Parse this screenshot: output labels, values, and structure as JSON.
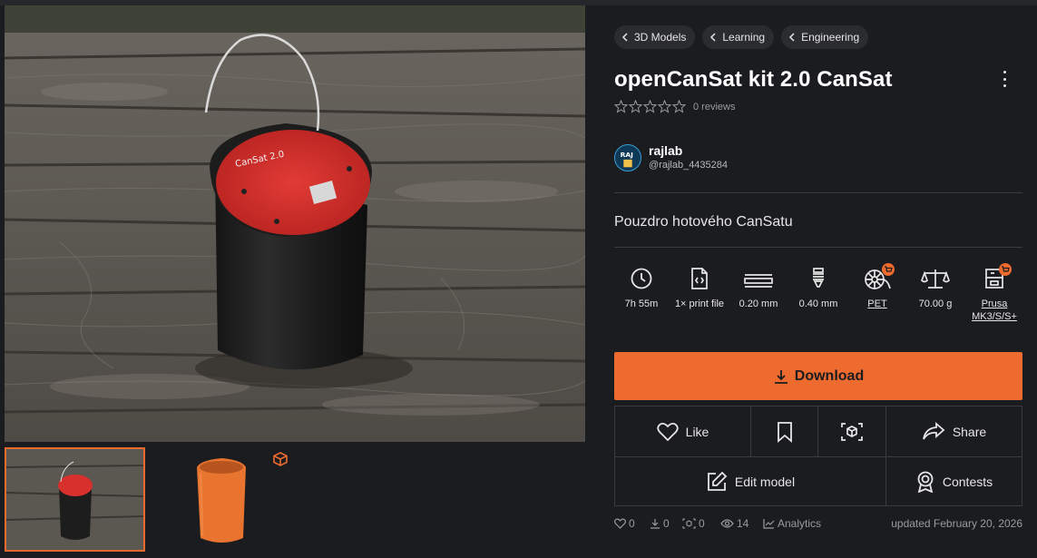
{
  "breadcrumbs": [
    {
      "label": "3D Models"
    },
    {
      "label": "Learning"
    },
    {
      "label": "Engineering"
    }
  ],
  "model": {
    "title": "openCanSat kit 2.0 CanSat",
    "rating": 0,
    "reviews_label": "0 reviews",
    "summary": "Pouzdro hotového CanSatu"
  },
  "author": {
    "name": "rajlab",
    "handle": "@rajlab_4435284"
  },
  "print_params": [
    {
      "icon": "clock-icon",
      "label": "7h 55m"
    },
    {
      "icon": "file-code-icon",
      "label": "1× print file"
    },
    {
      "icon": "layer-height-icon",
      "label": "0.20 mm"
    },
    {
      "icon": "nozzle-icon",
      "label": "0.40 mm"
    },
    {
      "icon": "filament-spool-icon",
      "label": "PET",
      "link": true
    },
    {
      "icon": "scale-icon",
      "label": "70.00 g"
    },
    {
      "icon": "printer-icon",
      "label_line1": "Prusa",
      "label_line2": "MK3/S/S+",
      "link": true
    }
  ],
  "buttons": {
    "download": "Download",
    "like": "Like",
    "share": "Share",
    "edit_model": "Edit model",
    "contests": "Contests"
  },
  "stats": {
    "likes": "0",
    "downloads": "0",
    "makes": "0",
    "views": "14",
    "analytics": "Analytics",
    "updated": "updated February 20, 2026"
  },
  "colors": {
    "accent": "#ed6b2f",
    "background": "#1b1c1f",
    "surface": "#2b2c30",
    "border": "#3a3b40"
  }
}
